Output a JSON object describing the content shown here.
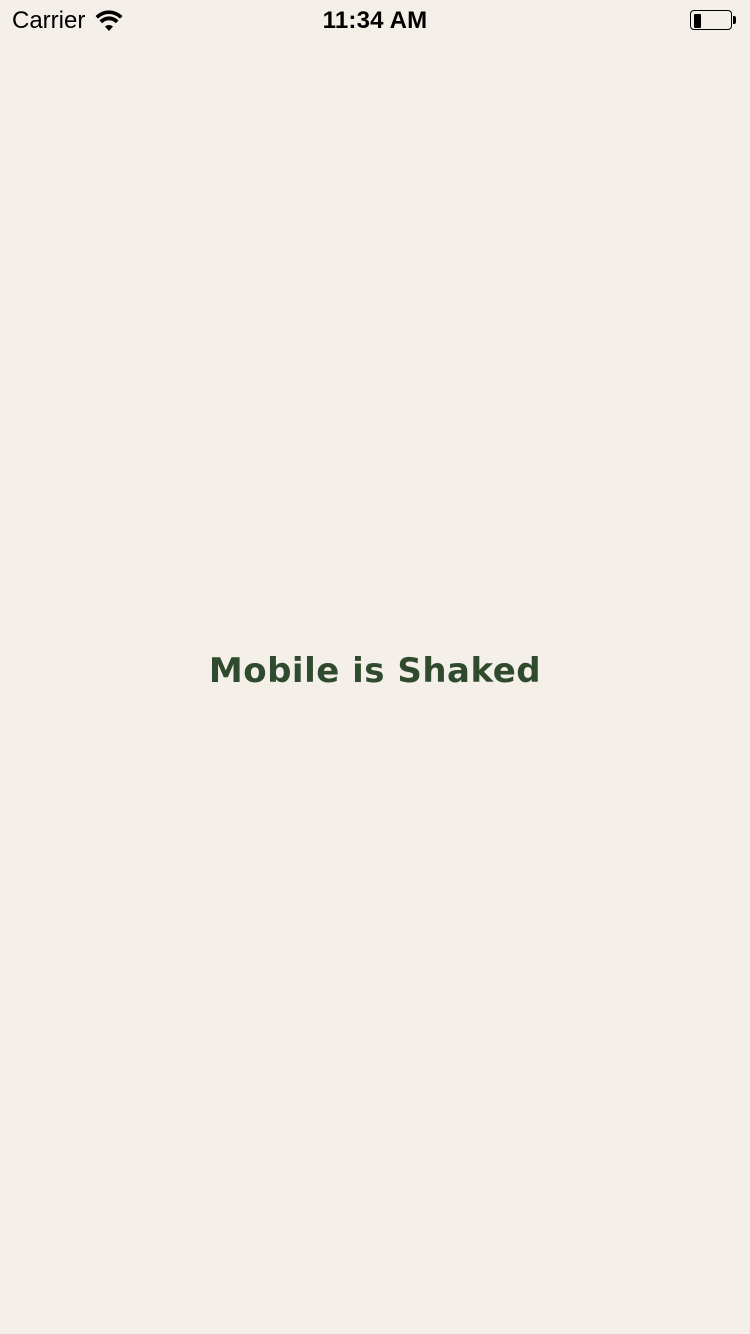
{
  "status_bar": {
    "carrier": "Carrier",
    "time": "11:34 AM",
    "wifi_icon": "wifi-icon",
    "battery_icon": "battery-icon",
    "battery_level": 0.2
  },
  "main": {
    "message": "Mobile is Shaked"
  },
  "colors": {
    "background": "#f4f0e9",
    "message_text": "#2f4a2c"
  }
}
